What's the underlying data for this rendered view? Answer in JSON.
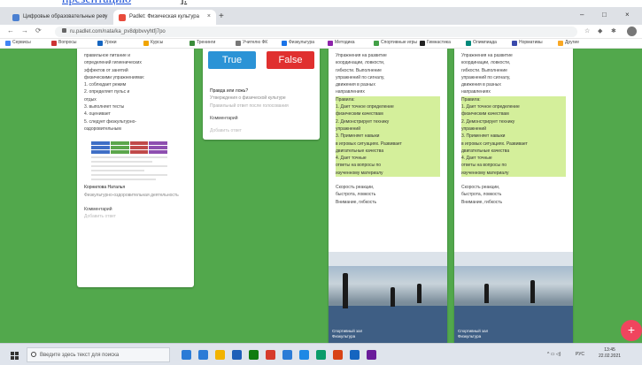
{
  "doc": {
    "link_text": "презентацию",
    "bracket": "]."
  },
  "browser": {
    "tabs": [
      {
        "title": "Цифровые образовательные ресу",
        "favicon_color": "#4a7fd1",
        "close": "×"
      },
      {
        "title": "Padlet: Физическая культура",
        "favicon_color": "#e84b3c",
        "close": "×"
      }
    ],
    "new_tab": "+",
    "window_controls": [
      "–",
      "□",
      "×"
    ],
    "nav": [
      "←",
      "→",
      "⟳"
    ],
    "url": "ru.padlet.com/nata/ka_pv8dpbvvyhtfj7po",
    "bookmarks": [
      {
        "label": "Сервисы",
        "color": "#4285f4"
      },
      {
        "label": "Вопросы",
        "color": "#c33"
      },
      {
        "label": "Уроки",
        "color": "#1565c0"
      },
      {
        "label": "Курсы",
        "color": "#f0a400"
      },
      {
        "label": "Тренинги",
        "color": "#3a8c3a"
      },
      {
        "label": "Учителю ФК",
        "color": "#777"
      },
      {
        "label": "Физкультура",
        "color": "#1a73e8"
      },
      {
        "label": "Методика",
        "color": "#8e24aa"
      },
      {
        "label": "Спортивные игры",
        "color": "#43a047"
      },
      {
        "label": "Гимнастика",
        "color": "#222"
      },
      {
        "label": "Олимпиада",
        "color": "#00897b"
      },
      {
        "label": "Нормативы",
        "color": "#3949ab"
      },
      {
        "label": "Другие",
        "color": "#f9a825"
      }
    ]
  },
  "card1": {
    "lines": [
      "правильное питание и",
      "определений гигиенических",
      "эффектов от занятий",
      "физическими упражнениями:",
      "1. соблюдает режим",
      "2. определяет пульс и",
      "отдых",
      "3. выполняет тесты",
      "4. оценивает",
      "5. следует физкультурно-",
      "оздоровительным"
    ],
    "author": "Корнилова Наталья",
    "note": "Физкультурно-оздоровительная деятельность",
    "comment": "Комментарий",
    "reply": "Добавить ответ"
  },
  "card2": {
    "true_label": "True",
    "false_label": "False",
    "meta": [
      "Правда или ложь?",
      "Утверждения о физической культуре",
      "Правильный ответ после голосования"
    ],
    "comment": "Комментарий",
    "reply": "Добавить ответ"
  },
  "card3": {
    "lines": [
      "Упражнения на развитие",
      "координации, ловкости,",
      "гибкости. Выполнение",
      "упражнений по сигналу,",
      "движения в разных",
      "направлениях"
    ],
    "highlights": [
      "Правила:",
      "1.      Дает точное определение",
      "физическим качествам",
      "2.      Демонстрирует технику",
      "упражнений",
      "3.      Применяет навыки",
      "в игровых ситуациях. Развивает",
      "двигательные качества",
      "4.      Дает точные",
      "ответы на вопросы по",
      "изученному материалу"
    ],
    "tail": [
      "Скорость реакции,",
      "быстрота, ловкость",
      "Внимание, гибкость"
    ],
    "caption": [
      "Спортивный зал",
      "Физкультура"
    ]
  },
  "card4": {
    "lines": [
      "Упражнения на развитие",
      "координации, ловкости,",
      "гибкости. Выполнение",
      "упражнений по сигналу,",
      "движения в разных",
      "направлениях"
    ],
    "highlights": [
      "Правила:",
      "1.      Дает точное определение",
      "физическим качествам",
      "2.      Демонстрирует технику",
      "упражнений",
      "3.      Применяет навыки",
      "в игровых ситуациях. Развивает",
      "двигательные качества",
      "4.      Дает точные",
      "ответы на вопросы по",
      "изученному материалу"
    ],
    "tail": [
      "Скорость реакции,",
      "быстрота, ловкость",
      "Внимание, гибкость"
    ],
    "caption": [
      "Спортивный зал",
      "Физкультура"
    ]
  },
  "fab": "+",
  "taskbar": {
    "search_placeholder": "Введите здесь текст для поиска",
    "apps": [
      "#2b7bd6",
      "#2b7bd6",
      "#f2b300",
      "#1f5fb8",
      "#0f7b0f",
      "#d63a2b",
      "#2b7bd6",
      "#1e88e5",
      "#0a9c6a",
      "#d84315",
      "#1565c0",
      "#6a1b9a"
    ],
    "tray_icons": "^ ▭ ◁)",
    "lang": "РУС",
    "time": "13:45",
    "date": "22.02.2021"
  }
}
